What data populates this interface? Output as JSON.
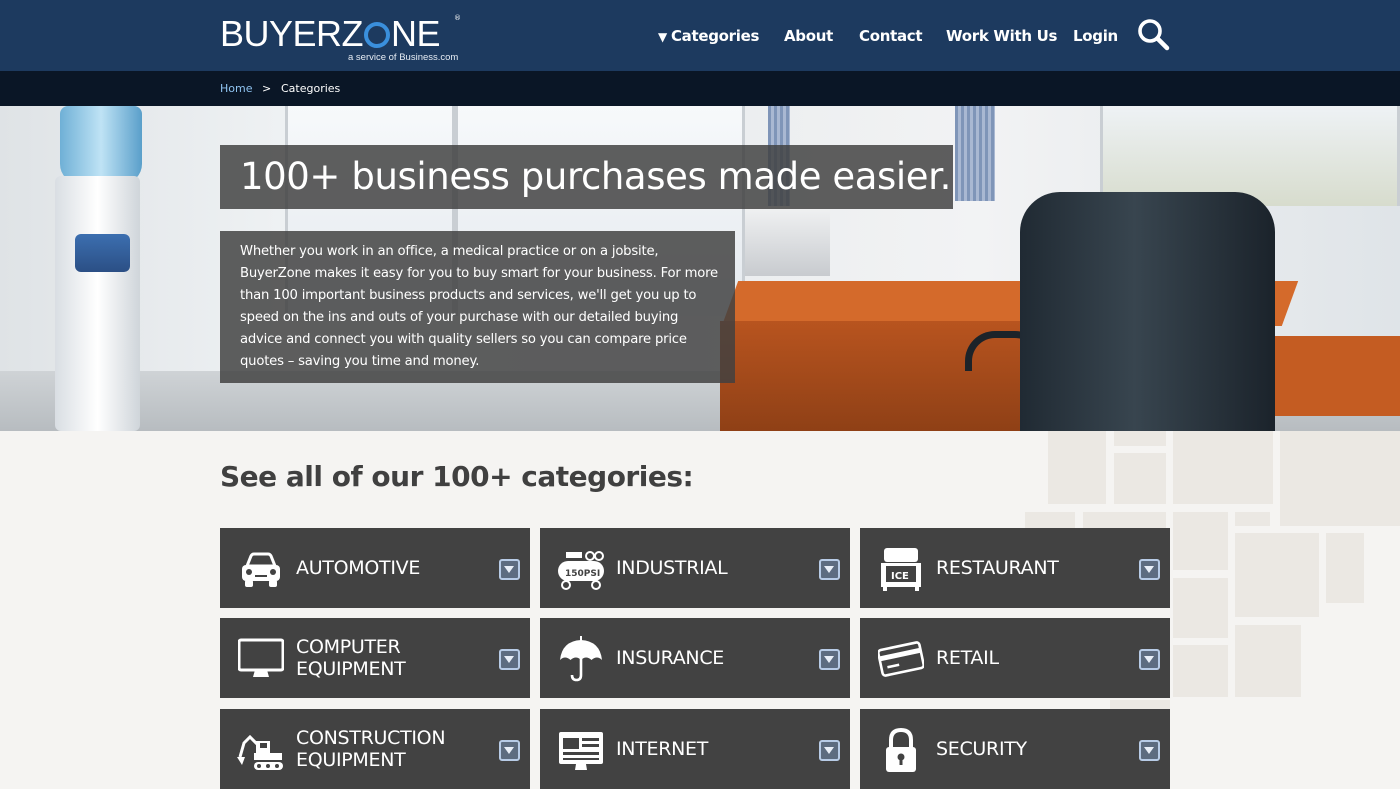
{
  "header": {
    "logo_text": "BUYERZONE",
    "logo_tagline": "a service of Business.com",
    "logo_reg_mark": "®",
    "nav": [
      {
        "label": "Categories",
        "caret": "▼"
      },
      {
        "label": "About"
      },
      {
        "label": "Contact"
      },
      {
        "label": "Work With Us"
      },
      {
        "label": "Login"
      }
    ],
    "search_icon": "search-icon"
  },
  "breadcrumb": {
    "home": "Home",
    "separator": ">",
    "current": "Categories"
  },
  "hero": {
    "title": "100+ business purchases made easier.",
    "body": "Whether you work in an office, a medical practice or on a jobsite, BuyerZone makes it easy for you to buy smart for your business. For more than 100 important business products and services, we'll get you up to speed on the ins and outs of your purchase with our detailed buying advice and connect you with quality sellers so you can compare price quotes – saving you time and money."
  },
  "categories": {
    "heading": "See all of our 100+ categories:",
    "items": [
      {
        "label": "AUTOMOTIVE",
        "icon": "car-icon"
      },
      {
        "label": "INDUSTRIAL",
        "icon": "compressor-icon",
        "icon_text": "150PSI"
      },
      {
        "label": "RESTAURANT",
        "icon": "ice-machine-icon",
        "icon_text": "ICE"
      },
      {
        "label": "COMPUTER EQUIPMENT",
        "icon": "monitor-icon"
      },
      {
        "label": "INSURANCE",
        "icon": "umbrella-icon"
      },
      {
        "label": "RETAIL",
        "icon": "credit-card-icon"
      },
      {
        "label": "CONSTRUCTION EQUIPMENT",
        "icon": "excavator-icon"
      },
      {
        "label": "INTERNET",
        "icon": "web-page-icon"
      },
      {
        "label": "SECURITY",
        "icon": "padlock-icon"
      }
    ]
  },
  "colors": {
    "header_bg": "#1d3a5f",
    "breadcrumb_bg": "#0a1626",
    "card_bg": "#424242",
    "page_bg": "#f5f4f2",
    "logo_accent": "#3a8fdc",
    "link": "#8fc3f0"
  }
}
